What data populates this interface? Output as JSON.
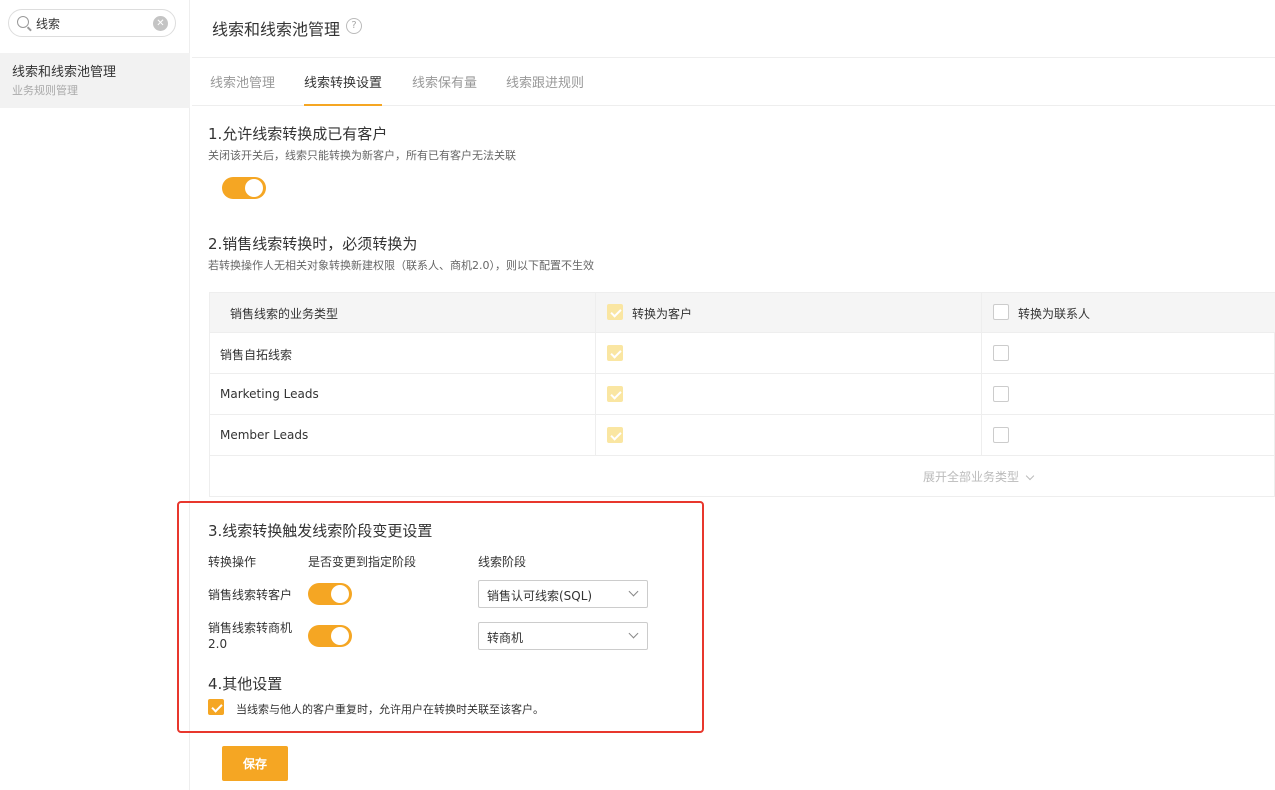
{
  "sidebar": {
    "search_value": "线索",
    "nav": {
      "title": "线索和线索池管理",
      "subtitle": "业务规则管理"
    }
  },
  "header": {
    "title": "线索和线索池管理",
    "help": "?"
  },
  "tabs": [
    {
      "label": "线索池管理",
      "active": false
    },
    {
      "label": "线索转换设置",
      "active": true
    },
    {
      "label": "线索保有量",
      "active": false
    },
    {
      "label": "线索跟进规则",
      "active": false
    }
  ],
  "section1": {
    "title": "1.允许线索转换成已有客户",
    "desc": "关闭该开关后，线索只能转换为新客户，所有已有客户无法关联",
    "toggle_on": true
  },
  "section2": {
    "title": "2.销售线索转换时，必须转换为",
    "desc": "若转换操作人无相关对象转换新建权限（联系人、商机2.0），则以下配置不生效",
    "table": {
      "headers": [
        "销售线索的业务类型",
        "转换为客户",
        "转换为联系人"
      ],
      "rows": [
        {
          "type": "销售自拓线索",
          "customer": true,
          "contact": false
        },
        {
          "type": "Marketing Leads",
          "customer": true,
          "contact": false
        },
        {
          "type": "Member Leads",
          "customer": true,
          "contact": false
        }
      ],
      "expand_label": "展开全部业务类型"
    }
  },
  "section3": {
    "title": "3.线索转换触发线索阶段变更设置",
    "col_labels": [
      "转换操作",
      "是否变更到指定阶段",
      "线索阶段"
    ],
    "rows": [
      {
        "action": "销售线索转客户",
        "action2": "",
        "toggle_on": true,
        "stage": "销售认可线索(SQL)"
      },
      {
        "action": "销售线索转商机",
        "action2": "2.0",
        "toggle_on": true,
        "stage": "转商机"
      }
    ]
  },
  "section4": {
    "title": "4.其他设置",
    "checkbox_label": "当线索与他人的客户重复时，允许用户在转换时关联至该客户。",
    "checked": true
  },
  "save_label": "保存",
  "colors": {
    "accent": "#f5a623",
    "highlight_border": "#e8372d"
  }
}
